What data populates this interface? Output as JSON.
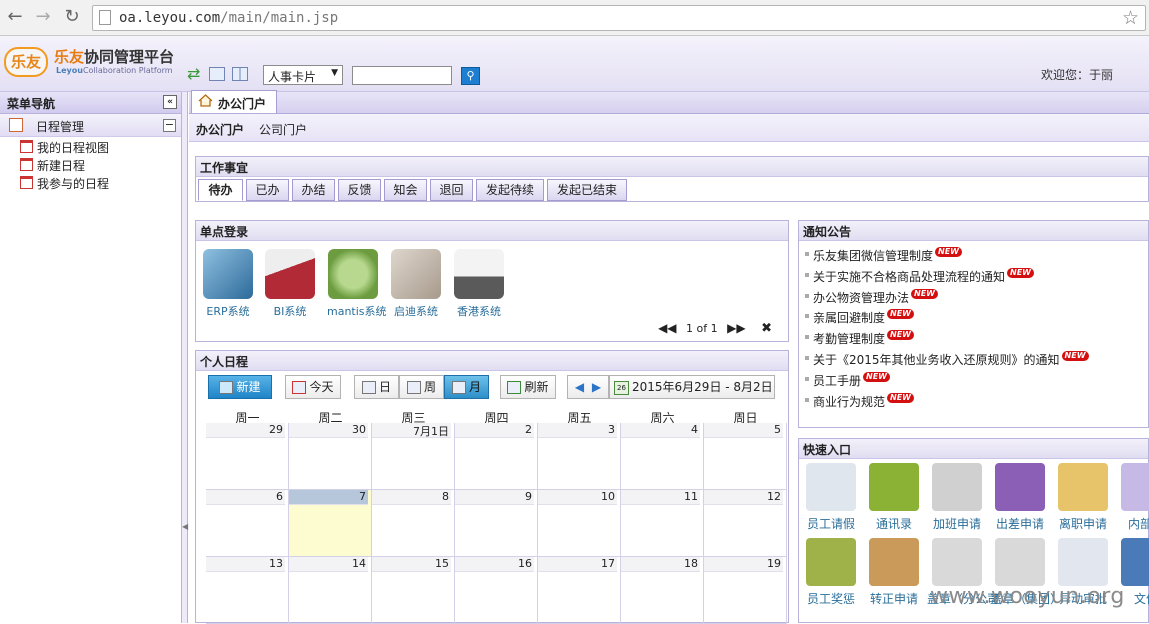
{
  "browser": {
    "url_host": "oa.leyou.com",
    "url_path": "/main/main.jsp",
    "back_icon": "back-arrow-icon",
    "forward_icon": "forward-arrow-icon",
    "reload_icon": "reload-icon",
    "star_icon": "bookmark-star-icon"
  },
  "header": {
    "logo_text": "乐友",
    "brand_accent": "乐友",
    "brand_rest": "协同管理平台",
    "brand_sub_en1": "Leyou",
    "brand_sub_en2": "Collaboration Platform",
    "select_value": "人事卡片",
    "search_placeholder": "",
    "welcome": "欢迎您：于丽",
    "accent_color": "#e97c11"
  },
  "sidebar": {
    "title": "菜单导航",
    "group": "日程管理",
    "items": [
      {
        "label": "我的日程视图"
      },
      {
        "label": "新建日程"
      },
      {
        "label": "我参与的日程"
      }
    ]
  },
  "tabs": {
    "home_tab": "办公门户",
    "subnav_active": "办公门户",
    "subnav_other": "公司门户"
  },
  "work": {
    "title": "工作事宜",
    "tabs": [
      "待办",
      "已办",
      "办结",
      "反馈",
      "知会",
      "退回",
      "发起待续",
      "发起已结束"
    ]
  },
  "sso": {
    "title": "单点登录",
    "systems": [
      {
        "label": "ERP系统",
        "color": "#3b7fb0"
      },
      {
        "label": "BI系统",
        "color": "#b12a35"
      },
      {
        "label": "mantis系统",
        "color": "#7fae4e"
      },
      {
        "label": "启迪系统",
        "color": "#b9aca0"
      },
      {
        "label": "香港系统",
        "color": "#6e6e6e"
      }
    ],
    "pager": "1 of 1"
  },
  "notice": {
    "title": "通知公告",
    "new_badge": "NEW",
    "items": [
      {
        "label": "乐友集团微信管理制度"
      },
      {
        "label": "关于实施不合格商品处理流程的通知"
      },
      {
        "label": "办公物资管理办法"
      },
      {
        "label": "亲属回避制度"
      },
      {
        "label": "考勤管理制度"
      },
      {
        "label": "关于《2015年其他业务收入还原规则》的通知"
      },
      {
        "label": "员工手册"
      },
      {
        "label": "商业行为规范"
      }
    ]
  },
  "calendar": {
    "title": "个人日程",
    "new_btn": "新建",
    "today_btn": "今天",
    "day_btn": "日",
    "week_btn": "周",
    "month_btn": "月",
    "refresh_btn": "刷新",
    "date_range": "2015年6月29日 - 8月2日",
    "range_icon_day": "26",
    "weekdays": [
      "周一",
      "周二",
      "周三",
      "周四",
      "周五",
      "周六",
      "周日"
    ],
    "weeks": [
      [
        "29",
        "30",
        "7月1日",
        "2",
        "3",
        "4",
        "5"
      ],
      [
        "6",
        "7",
        "8",
        "9",
        "10",
        "11",
        "12"
      ],
      [
        "13",
        "14",
        "15",
        "16",
        "17",
        "18",
        "19"
      ]
    ],
    "today_row": 1,
    "today_col": 1
  },
  "quick": {
    "title": "快速入口",
    "row1": [
      {
        "label": "员工请假",
        "color": "#dfe6ee"
      },
      {
        "label": "通讯录",
        "color": "#8bb234"
      },
      {
        "label": "加班申请",
        "color": "#d0d0d0"
      },
      {
        "label": "出差申请",
        "color": "#8a5fb5"
      },
      {
        "label": "离职申请",
        "color": "#e7c46a"
      },
      {
        "label": "内部管",
        "color": "#c7b9e6"
      }
    ],
    "row2": [
      {
        "label": "员工奖惩",
        "color": "#9fb24a"
      },
      {
        "label": "转正申请",
        "color": "#c99a5a"
      },
      {
        "label": "盖章（分公司）",
        "color": "#d9d9d9"
      },
      {
        "label": "盖章（集团）",
        "color": "#d9d9d9"
      },
      {
        "label": "异动审批",
        "color": "#e2e7ef"
      },
      {
        "label": "文件",
        "color": "#4a7ab8"
      }
    ]
  },
  "watermark": "www.wooyun.org"
}
